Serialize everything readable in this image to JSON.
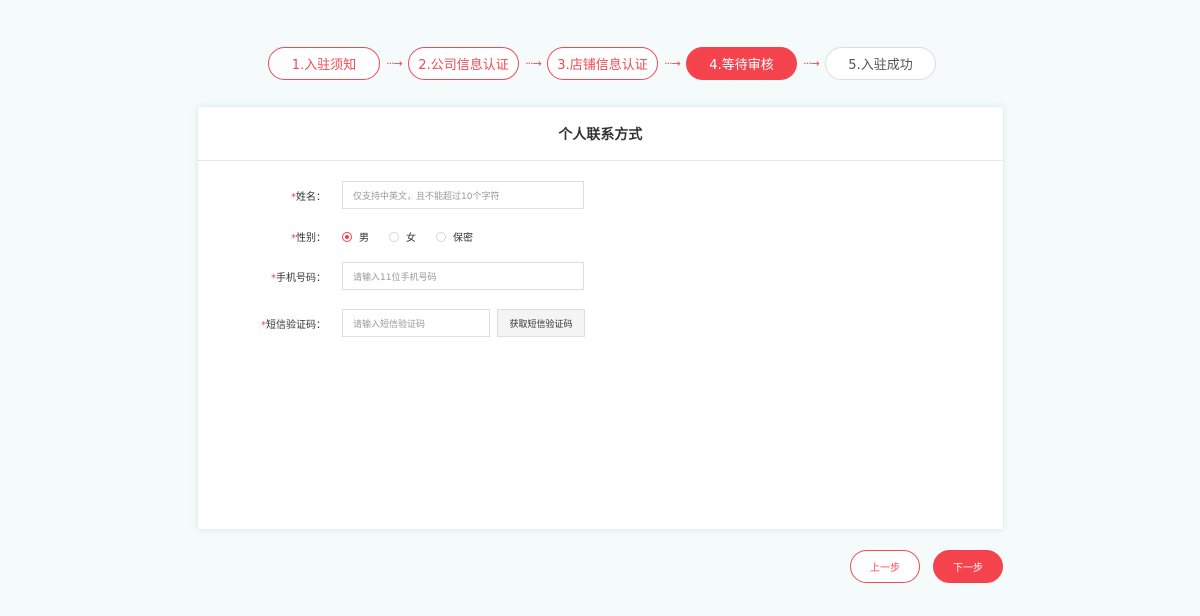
{
  "steps": [
    {
      "label": "1.入驻须知",
      "state": "done"
    },
    {
      "label": "2.公司信息认证",
      "state": "done"
    },
    {
      "label": "3.店铺信息认证",
      "state": "done"
    },
    {
      "label": "4.等待审核",
      "state": "active"
    },
    {
      "label": "5.入驻成功",
      "state": "todo"
    }
  ],
  "arrow_glyph": "···→",
  "form": {
    "title": "个人联系方式",
    "required_mark": "*",
    "name": {
      "label": "姓名：",
      "placeholder": "仅支持中英文，且不能超过10个字符"
    },
    "gender": {
      "label": "性别：",
      "options": [
        "男",
        "女",
        "保密"
      ],
      "selected": "男"
    },
    "phone": {
      "label": "手机号码：",
      "placeholder": "请输入11位手机号码"
    },
    "sms": {
      "label": "短信验证码：",
      "placeholder": "请输入短信验证码",
      "button_label": "获取短信验证码"
    }
  },
  "buttons": {
    "prev_label": "上一步",
    "next_label": "下一步"
  },
  "colors": {
    "accent": "#f5434e",
    "background": "#f5fbfa"
  }
}
